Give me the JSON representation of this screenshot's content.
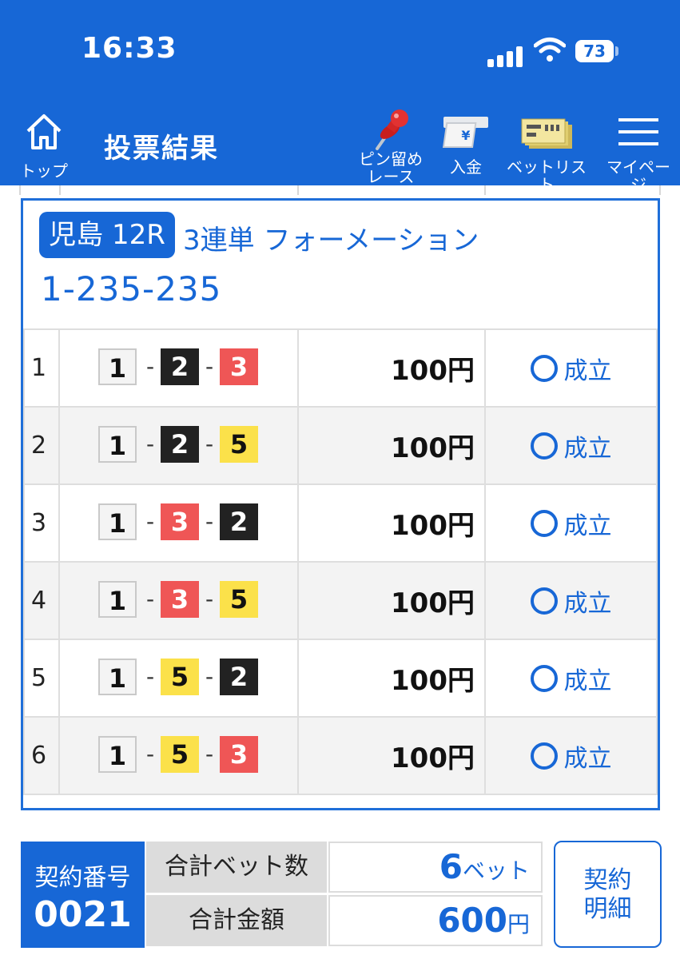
{
  "status": {
    "time": "16:33",
    "battery": "73"
  },
  "header": {
    "home_label": "トップ",
    "title": "投票結果",
    "pin_label_1": "ピン留め",
    "pin_label_2": "レース",
    "deposit_label": "入金",
    "betlist_label": "ベットリスト",
    "mypage_label": "マイページ",
    "deposit_icon_glyph": "¥"
  },
  "race": {
    "tag": "児島 12R",
    "bet_type": "3連単 フォーメーション",
    "combination": "1-235-235"
  },
  "bets": [
    {
      "no": "1",
      "first": "1",
      "second": "2",
      "third": "3",
      "amount": "100円",
      "status": "成立"
    },
    {
      "no": "2",
      "first": "1",
      "second": "2",
      "third": "5",
      "amount": "100円",
      "status": "成立"
    },
    {
      "no": "3",
      "first": "1",
      "second": "3",
      "third": "2",
      "amount": "100円",
      "status": "成立"
    },
    {
      "no": "4",
      "first": "1",
      "second": "3",
      "third": "5",
      "amount": "100円",
      "status": "成立"
    },
    {
      "no": "5",
      "first": "1",
      "second": "5",
      "third": "2",
      "amount": "100円",
      "status": "成立"
    },
    {
      "no": "6",
      "first": "1",
      "second": "5",
      "third": "3",
      "amount": "100円",
      "status": "成立"
    }
  ],
  "summary": {
    "contract_label": "契約番号",
    "contract_no": "0021",
    "bet_count_label": "合計ベット数",
    "bet_count": "6",
    "bet_count_unit": "ベット",
    "total_label": "合計金額",
    "total": "600",
    "total_unit": "円",
    "detail_line1": "契約",
    "detail_line2": "明細"
  },
  "colors": {
    "brand": "#1767d6",
    "boat2": "#222222",
    "boat3": "#ef5656",
    "boat5": "#fbe14a"
  }
}
